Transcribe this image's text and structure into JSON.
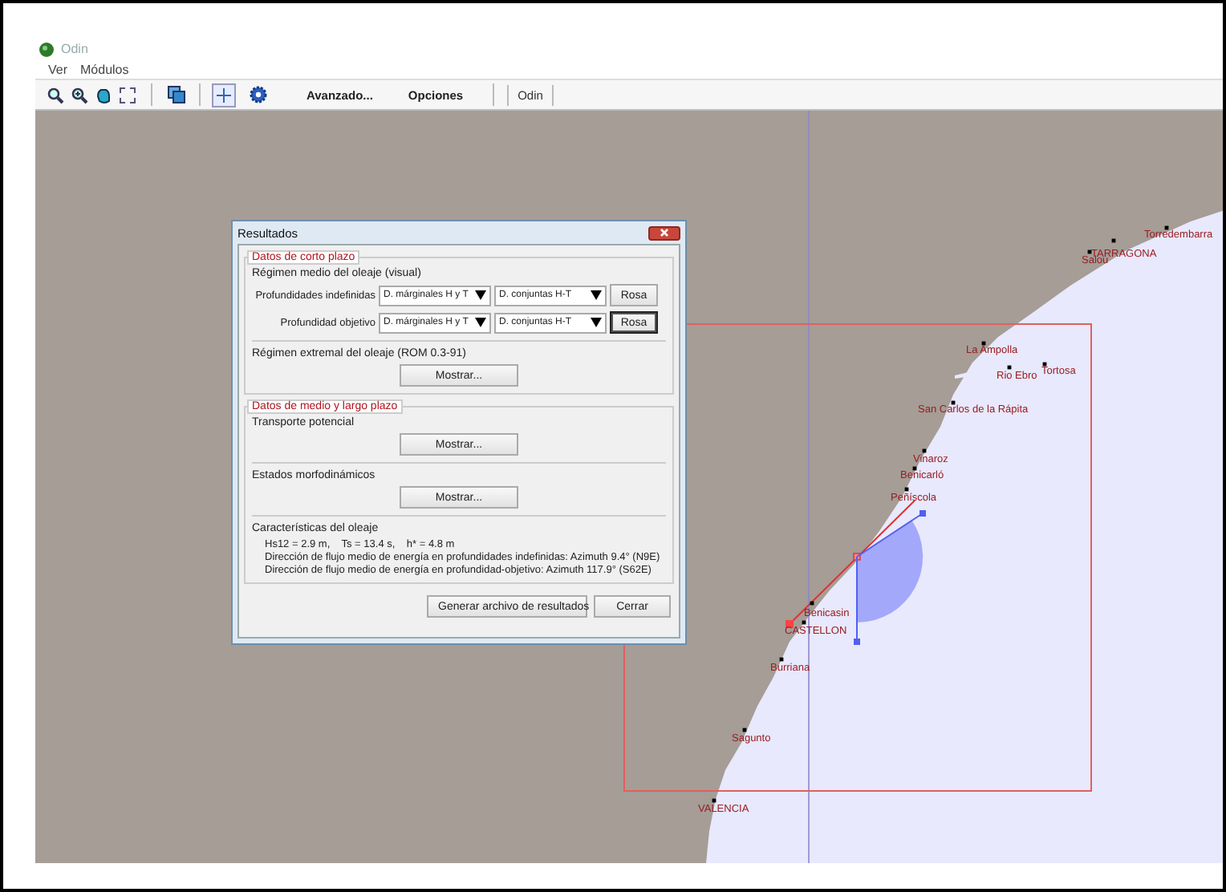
{
  "window": {
    "title": "Odin"
  },
  "menu": [
    "Ver",
    "Módulos"
  ],
  "toolbar": {
    "text_buttons": [
      "Avanzado...",
      "Opciones"
    ],
    "tab": "Odin",
    "crosshair_selected": true
  },
  "map": {
    "towns": [
      {
        "name": "Torredembarra"
      },
      {
        "name": "TARRAGONA"
      },
      {
        "name": "Salou"
      },
      {
        "name": "La Ampolla"
      },
      {
        "name": "Rio Ebro"
      },
      {
        "name": "Tortosa"
      },
      {
        "name": "San Carlos de la Rápita"
      },
      {
        "name": "Vinaroz"
      },
      {
        "name": "Benicarló"
      },
      {
        "name": "Peñíscola"
      },
      {
        "name": "Benicasin"
      },
      {
        "name": "CASTELLON"
      },
      {
        "name": "Burriana"
      },
      {
        "name": "Sagunto"
      },
      {
        "name": "VALENCIA"
      }
    ]
  },
  "dialog": {
    "title": "Resultados",
    "short_term": {
      "legend": "Datos de corto plazo",
      "heading": "Régimen medio del oleaje (visual)",
      "rows": [
        {
          "label": "Profundidades indefinidas",
          "dropdowns": [
            "D. márginales H y T",
            "D. conjuntas H-T"
          ],
          "button": "Rosa",
          "focused": false
        },
        {
          "label": "Profundidad objetivo",
          "dropdowns": [
            "D. márginales H y T",
            "D. conjuntas H-T"
          ],
          "button": "Rosa",
          "focused": true
        }
      ],
      "extremal": {
        "heading": "Régimen extremal del oleaje (ROM 0.3-91)",
        "button": "Mostrar..."
      }
    },
    "long_term": {
      "legend": "Datos de medio y largo plazo",
      "blocks": [
        {
          "heading": "Transporte potencial",
          "button": "Mostrar..."
        },
        {
          "heading": "Estados morfodinámicos",
          "button": "Mostrar..."
        }
      ],
      "wave": {
        "heading": "Características del oleaje",
        "lines": [
          "Hs12 = 2.9 m,    Ts = 13.4 s,    h* = 4.8 m",
          "Dirección de flujo medio de energía en profundidades indefinidas: Azimuth 9.4° (N9E)",
          "Dirección de flujo medio de energía en profundidad-objetivo: Azimuth 117.9° (S62E)"
        ]
      }
    },
    "buttons": [
      "Generar archivo de resultados",
      "Cerrar"
    ]
  }
}
